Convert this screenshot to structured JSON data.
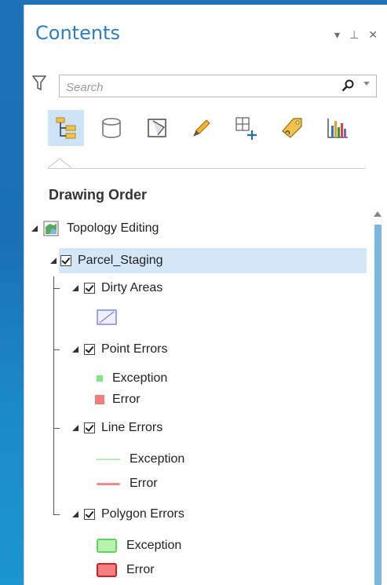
{
  "pane": {
    "title": "Contents",
    "controls": [
      "▾",
      "⊥",
      "✕"
    ]
  },
  "search": {
    "placeholder": "Search"
  },
  "toolbar": {
    "buttons": [
      {
        "icon": "list-by-drawing-order-icon",
        "active": true
      },
      {
        "icon": "list-by-source-icon"
      },
      {
        "icon": "list-by-selection-icon"
      },
      {
        "icon": "list-by-editing-icon"
      },
      {
        "icon": "list-by-snapping-icon"
      },
      {
        "icon": "list-by-labeling-icon"
      },
      {
        "icon": "list-by-charts-icon"
      }
    ]
  },
  "section": {
    "title": "Drawing Order"
  },
  "tree": {
    "map": {
      "label": "Topology Editing"
    },
    "group": {
      "label": "Parcel_Staging"
    },
    "layers": [
      {
        "label": "Dirty Areas"
      },
      {
        "label": "Point Errors",
        "legend": [
          {
            "label": "Exception",
            "color": "#7ee87e"
          },
          {
            "label": "Error",
            "color": "#f27b7b"
          }
        ]
      },
      {
        "label": "Line Errors",
        "legend": [
          {
            "label": "Exception",
            "color": "#b6ebb6"
          },
          {
            "label": "Error",
            "color": "#f08c8c"
          }
        ]
      },
      {
        "label": "Polygon Errors",
        "legend": [
          {
            "label": "Exception",
            "color": "#b9f3b0"
          },
          {
            "label": "Error",
            "color": "#f57f7f"
          }
        ]
      }
    ]
  },
  "colors": {
    "accent": "#2b7fc4",
    "selection": "#d3e7f7",
    "background_blue": "#1d72b8"
  }
}
